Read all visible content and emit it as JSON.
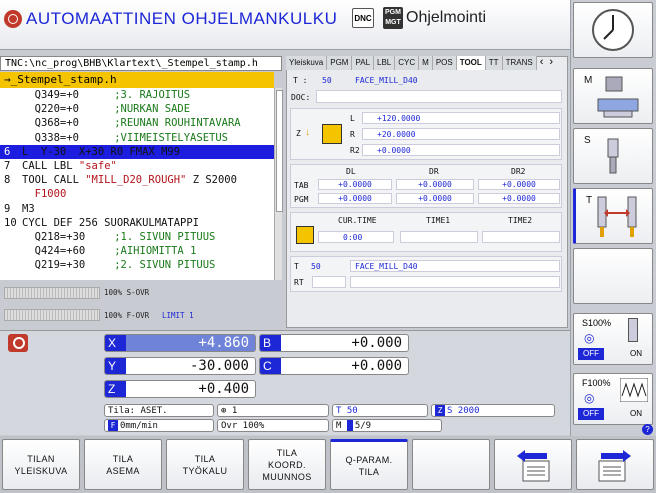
{
  "header": {
    "title": "AUTOMAATTINEN OHJELMANKULKU",
    "dnc": "DNC",
    "pgm_mgt": "PGM MGT",
    "secondary_title": "Ohjelmointi"
  },
  "program": {
    "path": "TNC:\\nc_prog\\BHB\\Klartext\\_Stempel_stamp.h",
    "file": "→_Stempel_stamp.h",
    "lines": [
      {
        "n": "",
        "code": "  Q349=+0",
        "comment": ";3. RAJOITUS"
      },
      {
        "n": "",
        "code": "  Q220=+0",
        "comment": ";NURKAN SADE"
      },
      {
        "n": "",
        "code": "  Q368=+0",
        "comment": ";REUNAN ROUHINTAVARA"
      },
      {
        "n": "",
        "code": "  Q338=+0",
        "comment": ";VIIMEISTELYASETUS"
      },
      {
        "n": "6",
        "code": "L  Y-30  X+30 R0 FMAX M99",
        "comment": ""
      },
      {
        "n": "7",
        "code": "CALL LBL ",
        "str": "\"safe\""
      },
      {
        "n": "8",
        "code": "TOOL CALL ",
        "str": "\"MILL_D20_ROUGH\"",
        "tail": " Z S2000"
      },
      {
        "n": "",
        "code": "  ",
        "str": "F1000"
      },
      {
        "n": "9",
        "code": "M3",
        "comment": ""
      },
      {
        "n": "10",
        "code": "CYCL DEF 256 SUORAKULMATAPPI",
        "comment": ""
      },
      {
        "n": "",
        "code": "  Q218=+30",
        "comment": ";1. SIVUN PITUUS"
      },
      {
        "n": "",
        "code": "  Q424=+60",
        "comment": ";AIHIOMITTA 1"
      },
      {
        "n": "",
        "code": "  Q219=+30",
        "comment": ";2. SIVUN PITUUS"
      }
    ],
    "selected_index": 4,
    "s_ovr": "100% S-OVR",
    "f_ovr": "100% F-OVR",
    "limit": "LIMIT 1"
  },
  "status": {
    "tabs": [
      "Yleiskuva",
      "PGM",
      "PAL",
      "LBL",
      "CYC",
      "M",
      "POS",
      "TOOL",
      "TT",
      "TRANS"
    ],
    "active_tab": "TOOL",
    "tool_header": {
      "t_label": "T :",
      "t_num": "50",
      "t_name": "FACE_MILL_D40",
      "doc_label": "DOC:"
    },
    "geometry": {
      "z_label": "Z",
      "l_label": "L",
      "l_val": "+120.0000",
      "r_label": "R",
      "r_val": "+20.0000",
      "r2_label": "R2",
      "r2_val": "+0.0000"
    },
    "deltas": {
      "dl": "DL",
      "dr": "DR",
      "dr2": "DR2",
      "tab_label": "TAB",
      "tab_vals": [
        "+0.0000",
        "+0.0000",
        "+0.0000"
      ],
      "pgm_label": "PGM",
      "pgm_vals": [
        "+0.0000",
        "+0.0000",
        "+0.0000"
      ]
    },
    "times": {
      "cur_time": "CUR.TIME",
      "time1": "TIME1",
      "time2": "TIME2",
      "cur_val": "0:00"
    },
    "next": {
      "t_label": "T",
      "t_num": "50",
      "t_name": "FACE_MILL_D40",
      "rt_label": "RT"
    }
  },
  "position": {
    "axes": [
      {
        "axis": "X",
        "value": "+4.860"
      },
      {
        "axis": "Y",
        "value": "-30.000"
      },
      {
        "axis": "Z",
        "value": "+0.400"
      },
      {
        "axis": "B",
        "value": "+0.000"
      },
      {
        "axis": "C",
        "value": "+0.000"
      }
    ],
    "mode": "Tila: ASET.",
    "datum": "1",
    "tool": "T 50",
    "spindle_axis": "Z",
    "spindle": "S 2000",
    "feed_icon": "F",
    "feed": "0mm/min",
    "ovr": "Ovr 100%",
    "m_label": "M",
    "m_val": "5/9"
  },
  "right_keys": {
    "m": "M",
    "s": "S",
    "t": "T",
    "s100": "S100%",
    "f100": "F100%",
    "off": "OFF",
    "on": "ON",
    "help": "?"
  },
  "bottom_keys": [
    "TILAN\nYLEISKUVA",
    "TILA\nASEMA",
    "TILA\nTYÖKALU",
    "TILA\nKOORD.\nMUUNNOS",
    "Q-PARAM.\nTILA"
  ],
  "colors": {
    "accent": "#1d27d6",
    "highlight": "#f5c400",
    "alarm": "#c0392b"
  }
}
